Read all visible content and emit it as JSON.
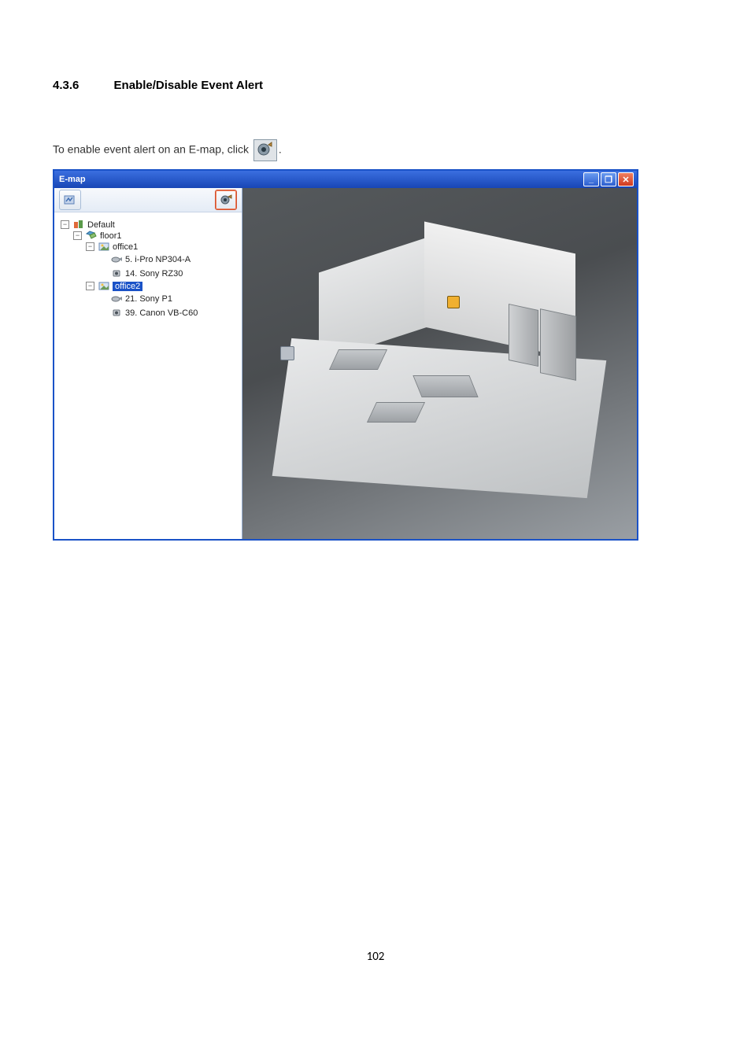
{
  "section": {
    "number": "4.3.6",
    "title": "Enable/Disable Event Alert"
  },
  "paragraph": {
    "prefix": "To enable event alert on an E-map, click ",
    "suffix": "."
  },
  "window": {
    "title": "E-map",
    "controls": {
      "min": "_",
      "max": "❐",
      "close": "✕"
    }
  },
  "tree": {
    "root": "Default",
    "floor": "floor1",
    "office1": {
      "label": "office1",
      "cam1": "5. i-Pro NP304-A",
      "cam2": "14. Sony RZ30"
    },
    "office2": {
      "label": "office2",
      "cam1": "21. Sony P1",
      "cam2": "39. Canon VB-C60"
    }
  },
  "page_number": "102"
}
